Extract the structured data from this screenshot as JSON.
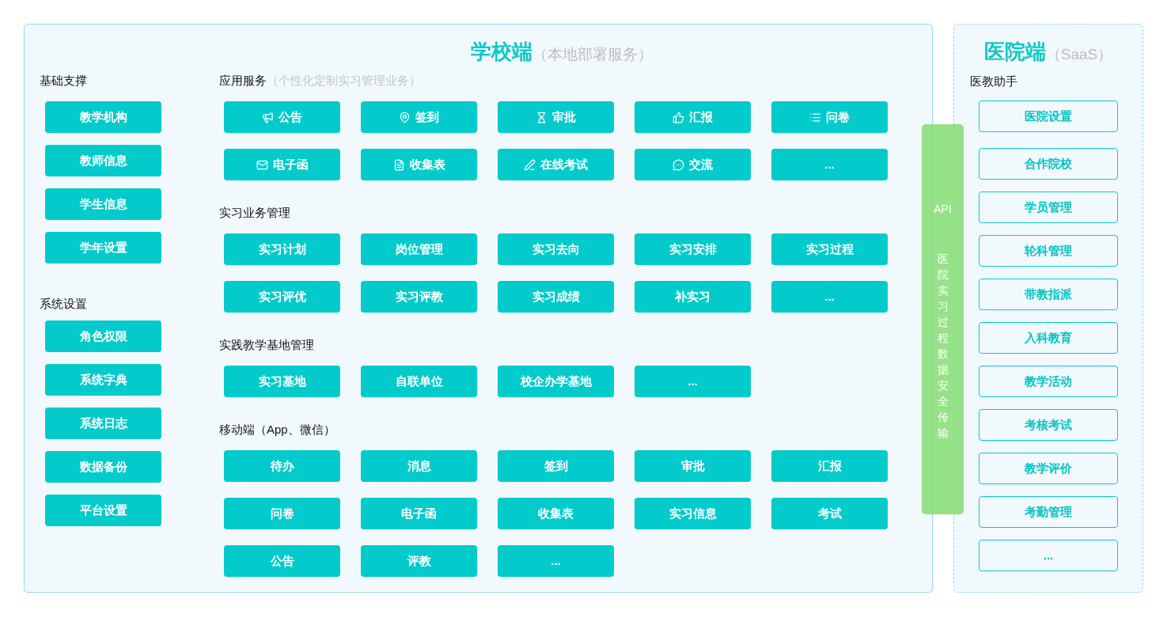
{
  "school": {
    "title": "学校端",
    "subtitle": "（本地部署服务）",
    "left_sections": [
      {
        "title": "基础支撑",
        "items": [
          "教学机构",
          "教师信息",
          "学生信息",
          "学年设置"
        ]
      },
      {
        "title": "系统设置",
        "items": [
          "角色权限",
          "系统字典",
          "系统日志",
          "数据备份",
          "平台设置"
        ]
      }
    ],
    "right_sections": [
      {
        "title": "应用服务",
        "subtitle": "（个性化定制实习管理业务）",
        "items": [
          {
            "label": "公告",
            "kind": "icon"
          },
          {
            "label": "签到",
            "kind": "icon"
          },
          {
            "label": "审批",
            "kind": "icon"
          },
          {
            "label": "汇报",
            "kind": "icon"
          },
          {
            "label": "问卷",
            "kind": "icon"
          },
          {
            "label": "电子函",
            "kind": "icon"
          },
          {
            "label": "收集表",
            "kind": "icon"
          },
          {
            "label": "在线考试",
            "kind": "icon"
          },
          {
            "label": "交流",
            "kind": "icon"
          },
          {
            "label": "...",
            "kind": "plain"
          }
        ]
      },
      {
        "title": "实习业务管理",
        "items": [
          {
            "label": "实习计划",
            "kind": "plain"
          },
          {
            "label": "岗位管理",
            "kind": "plain"
          },
          {
            "label": "实习去向",
            "kind": "plain"
          },
          {
            "label": "实习安排",
            "kind": "plain"
          },
          {
            "label": "实习过程",
            "kind": "plain"
          },
          {
            "label": "实习评优",
            "kind": "plain"
          },
          {
            "label": "实习评教",
            "kind": "plain"
          },
          {
            "label": "实习成绩",
            "kind": "plain"
          },
          {
            "label": "补实习",
            "kind": "plain"
          },
          {
            "label": "...",
            "kind": "plain"
          }
        ]
      },
      {
        "title": "实践教学基地管理",
        "items": [
          {
            "label": "实习基地",
            "kind": "plain"
          },
          {
            "label": "自联单位",
            "kind": "plain"
          },
          {
            "label": "校企办学基地",
            "kind": "plain"
          },
          {
            "label": "...",
            "kind": "plain"
          }
        ]
      },
      {
        "title": "移动端（App、微信）",
        "items": [
          {
            "label": "待办",
            "kind": "plain"
          },
          {
            "label": "消息",
            "kind": "plain"
          },
          {
            "label": "签到",
            "kind": "plain"
          },
          {
            "label": "审批",
            "kind": "plain"
          },
          {
            "label": "汇报",
            "kind": "plain"
          },
          {
            "label": "问卷",
            "kind": "plain"
          },
          {
            "label": "电子函",
            "kind": "plain"
          },
          {
            "label": "收集表",
            "kind": "plain"
          },
          {
            "label": "实习信息",
            "kind": "plain"
          },
          {
            "label": "考试",
            "kind": "plain"
          },
          {
            "label": "公告",
            "kind": "plain"
          },
          {
            "label": "评教",
            "kind": "plain"
          },
          {
            "label": "...",
            "kind": "plain"
          }
        ]
      }
    ]
  },
  "hospital": {
    "title": "医院端",
    "subtitle": "（SaaS）",
    "section_title": "医教助手",
    "items": [
      "医院设置",
      "合作院校",
      "学员管理",
      "轮科管理",
      "带教指派",
      "入科教育",
      "教学活动",
      "考核考试",
      "教学评价",
      "考勤管理",
      "..."
    ]
  },
  "api_bar": {
    "label": "API",
    "caption": "医院实习过程数据安全传输"
  }
}
